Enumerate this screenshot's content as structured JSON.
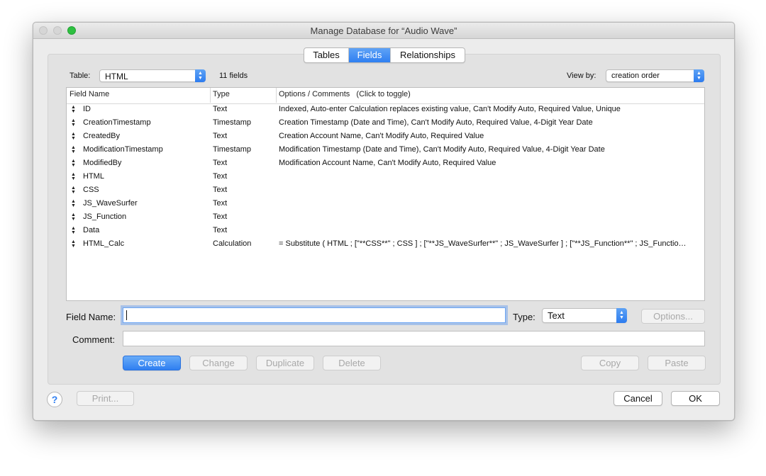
{
  "window": {
    "title": "Manage Database for “Audio Wave”"
  },
  "tabs": [
    {
      "label": "Tables",
      "active": false
    },
    {
      "label": "Fields",
      "active": true
    },
    {
      "label": "Relationships",
      "active": false
    }
  ],
  "table_picker": {
    "label": "Table:",
    "value": "HTML",
    "count_text": "11 fields"
  },
  "view_by": {
    "label": "View by:",
    "value": "creation order"
  },
  "fields_table": {
    "columns": [
      "Field Name",
      "Type",
      "Options / Comments   (Click to toggle)"
    ],
    "rows": [
      {
        "name": "ID",
        "type": "Text",
        "options": "Indexed, Auto-enter Calculation replaces existing value, Can't Modify Auto, Required Value, Unique"
      },
      {
        "name": "CreationTimestamp",
        "type": "Timestamp",
        "options": "Creation Timestamp (Date and Time), Can't Modify Auto, Required Value, 4-Digit Year Date"
      },
      {
        "name": "CreatedBy",
        "type": "Text",
        "options": "Creation Account Name, Can't Modify Auto, Required Value"
      },
      {
        "name": "ModificationTimestamp",
        "type": "Timestamp",
        "options": "Modification Timestamp (Date and Time), Can't Modify Auto, Required Value, 4-Digit Year Date"
      },
      {
        "name": "ModifiedBy",
        "type": "Text",
        "options": "Modification Account Name, Can't Modify Auto, Required Value"
      },
      {
        "name": "HTML",
        "type": "Text",
        "options": ""
      },
      {
        "name": "CSS",
        "type": "Text",
        "options": ""
      },
      {
        "name": "JS_WaveSurfer",
        "type": "Text",
        "options": ""
      },
      {
        "name": "JS_Function",
        "type": "Text",
        "options": ""
      },
      {
        "name": "Data",
        "type": "Text",
        "options": ""
      },
      {
        "name": "HTML_Calc",
        "type": "Calculation",
        "options": "= Substitute ( HTML ;  [\"**CSS**\" ; CSS ] ; [\"**JS_WaveSurfer**\" ; JS_WaveSurfer ] ; [\"**JS_Function**\" ; JS_Functio…"
      }
    ]
  },
  "form": {
    "field_name_label": "Field Name:",
    "field_name_value": "",
    "type_label": "Type:",
    "type_value": "Text",
    "options_button": "Options...",
    "comment_label": "Comment:",
    "comment_value": ""
  },
  "actions": {
    "create": "Create",
    "change": "Change",
    "duplicate": "Duplicate",
    "delete": "Delete",
    "copy": "Copy",
    "paste": "Paste"
  },
  "footer": {
    "help": "?",
    "print": "Print...",
    "cancel": "Cancel",
    "ok": "OK"
  }
}
